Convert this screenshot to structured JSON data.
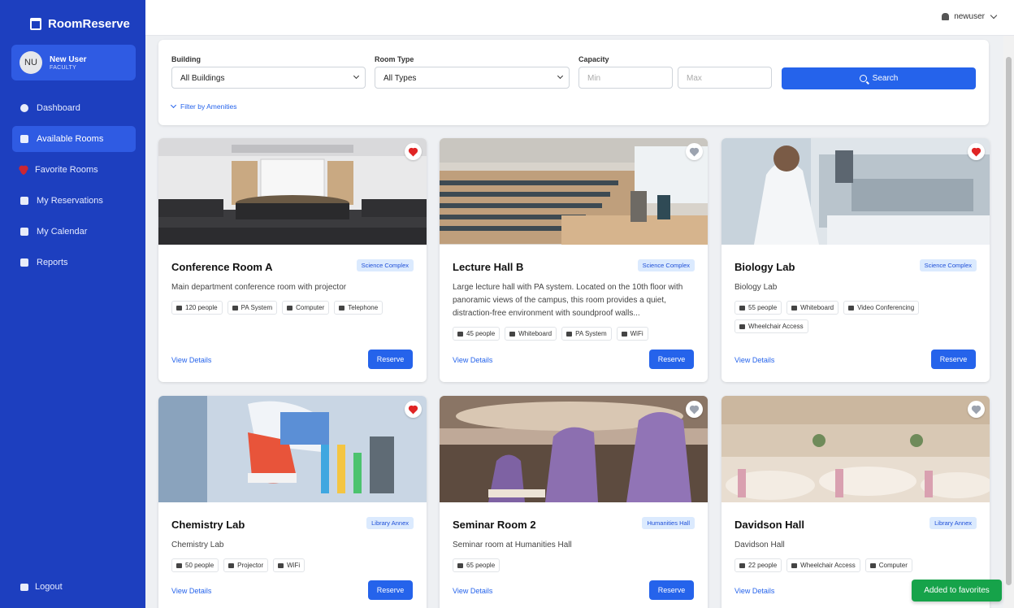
{
  "brand": {
    "name": "RoomReserve"
  },
  "user": {
    "initials": "NU",
    "name": "New User",
    "role": "FACULTY"
  },
  "nav": [
    {
      "label": "Dashboard",
      "icon": "dashboard-icon"
    },
    {
      "label": "Available Rooms",
      "icon": "door-icon",
      "active": true
    },
    {
      "label": "Favorite Rooms",
      "icon": "heart-icon"
    },
    {
      "label": "My Reservations",
      "icon": "calendar-check-icon"
    },
    {
      "label": "My Calendar",
      "icon": "calendar-icon"
    },
    {
      "label": "Reports",
      "icon": "file-icon"
    }
  ],
  "logout_label": "Logout",
  "topbar": {
    "username": "newuser"
  },
  "filter": {
    "building_label": "Building",
    "building_value": "All Buildings",
    "roomtype_label": "Room Type",
    "roomtype_value": "All Types",
    "capacity_label": "Capacity",
    "min_placeholder": "Min",
    "max_placeholder": "Max",
    "search_label": "Search",
    "amenities_label": "Filter by Amenities"
  },
  "rooms": [
    {
      "title": "Conference Room A",
      "building": "Science Complex",
      "description": "Main department conference room with projector",
      "tags": [
        "120 people",
        "PA System",
        "Computer",
        "Telephone"
      ],
      "favorite": true
    },
    {
      "title": "Lecture Hall B",
      "building": "Science Complex",
      "description": "Large lecture hall with PA system. Located on the 10th floor with panoramic views of the campus, this room provides a quiet, distraction-free environment with soundproof walls...",
      "tags": [
        "45 people",
        "Whiteboard",
        "PA System",
        "WiFi"
      ],
      "favorite": false
    },
    {
      "title": "Biology Lab",
      "building": "Science Complex",
      "description": "Biology Lab",
      "tags": [
        "55 people",
        "Whiteboard",
        "Video Conferencing",
        "Wheelchair Access"
      ],
      "favorite": true
    },
    {
      "title": "Chemistry Lab",
      "building": "Library Annex",
      "description": "Chemistry Lab",
      "tags": [
        "50 people",
        "Projector",
        "WiFi"
      ],
      "favorite": true
    },
    {
      "title": "Seminar Room 2",
      "building": "Humanities Hall",
      "description": "Seminar room at Humanities Hall",
      "tags": [
        "65 people"
      ],
      "favorite": false
    },
    {
      "title": "Davidson Hall",
      "building": "Library Annex",
      "description": "Davidson Hall",
      "tags": [
        "22 people",
        "Wheelchair Access",
        "Computer"
      ],
      "favorite": false
    }
  ],
  "card_actions": {
    "view_label": "View Details",
    "reserve_label": "Reserve"
  },
  "toast": "Added to favorites",
  "colors": {
    "sidebar": "#1d3fbf",
    "accent": "#2563eb",
    "favorite": "#e02424",
    "toast": "#16a34a"
  }
}
